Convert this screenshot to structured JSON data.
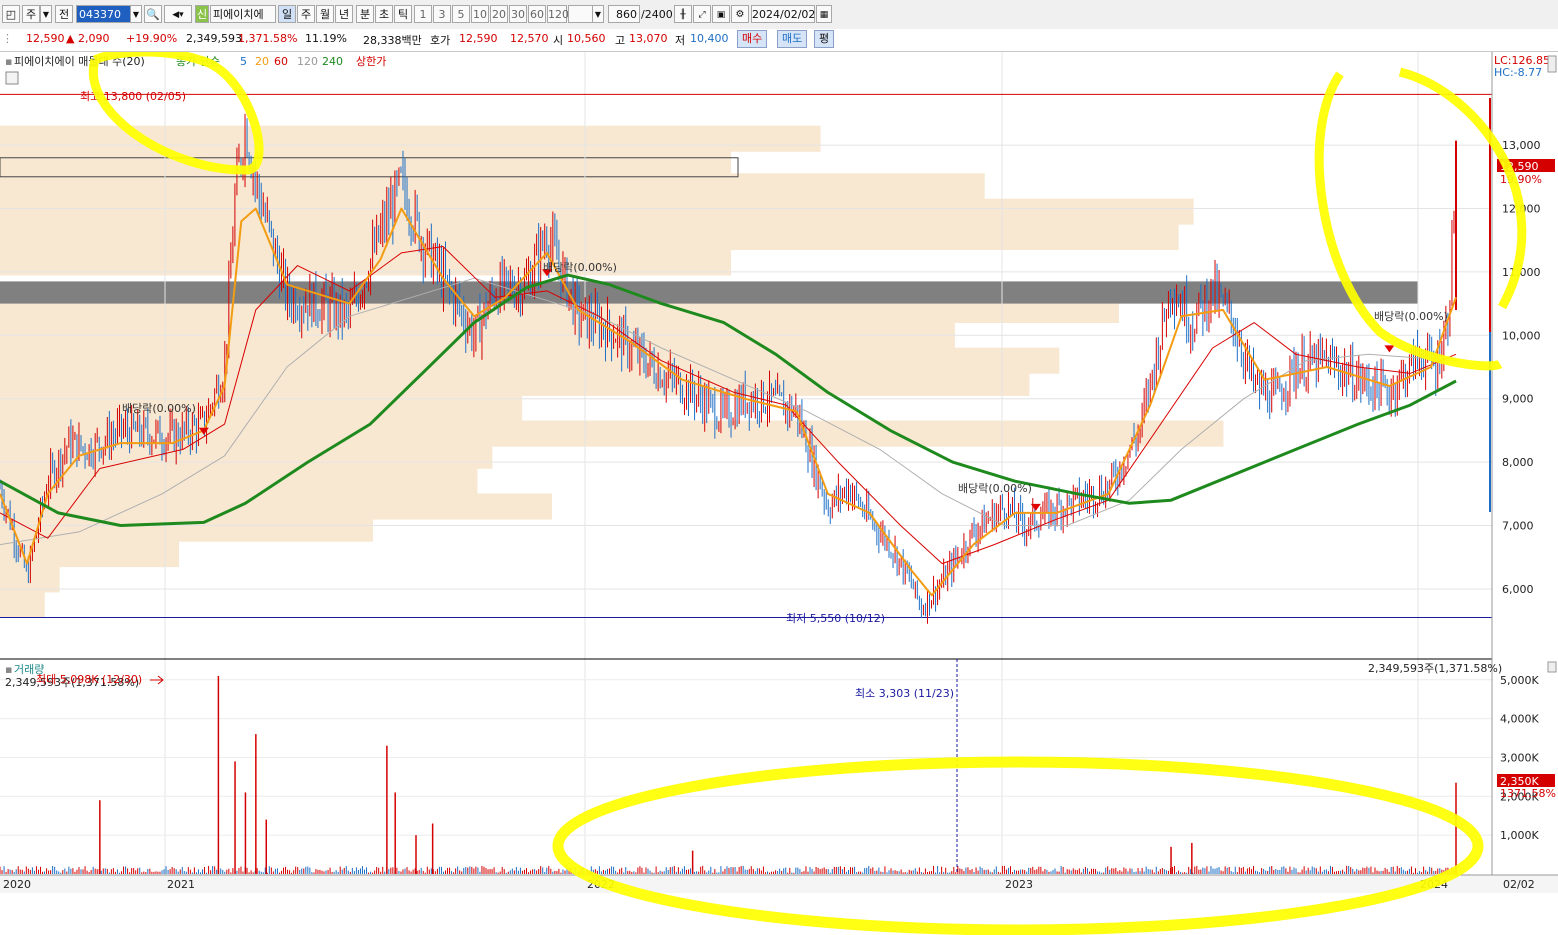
{
  "toolbar": {
    "period_main": "주",
    "prev": "전",
    "code": "043370",
    "stock_badge": "신",
    "stock_name": "피에이치에",
    "periods": [
      "일",
      "주",
      "월",
      "년",
      "분",
      "초",
      "틱"
    ],
    "active_period": "일",
    "intervals": [
      "1",
      "3",
      "5",
      "10",
      "20",
      "30",
      "60",
      "120"
    ],
    "count": "860",
    "count_total": "/2400",
    "date": "2024/02/02"
  },
  "quote": {
    "price": "12,590",
    "change": "▲ 2,090",
    "change_pct": "+19.90%",
    "volume": "2,349,593",
    "volume_pct": "1,371.58%",
    "turnover": "11.19%",
    "amount": "28,338백만",
    "ask_label": "호가",
    "ask": "12,590",
    "bid": "12,570",
    "open_label": "시",
    "open": "10,560",
    "high_label": "고",
    "high": "13,070",
    "low_label": "저",
    "low": "10,400",
    "buy": "매수",
    "sell": "매도",
    "avg": "평"
  },
  "colors": {
    "up": "#d40000",
    "down": "#1d6fc6",
    "ma5": "#f39c12",
    "ma20": "#d80000",
    "ma60": "#b0b0b0",
    "ma240": "#1e8a1e",
    "highlight": "#ffff00",
    "volume_profile": "#f8e8d2"
  },
  "chart_data": {
    "type": "line",
    "title": "피에이치에이 매물대 수(20)",
    "legend": [
      "종가 단순",
      "5",
      "20",
      "60",
      "120",
      "240",
      "상한가"
    ],
    "x_ticks": [
      "2020",
      "2021",
      "2022",
      "2023",
      "2024",
      "02/02"
    ],
    "ylim": [
      5400,
      13900
    ],
    "y_ticks": [
      "13,000",
      "12,000",
      "11,000",
      "10,000",
      "9,000",
      "8,000",
      "7,000",
      "6,000"
    ],
    "right_labels": {
      "lc": "LC:126.85",
      "hc": "HC:-8.77",
      "price": "12,590",
      "pct": "19.90%"
    },
    "max_label": "최고 13,800 (02/05)",
    "max_value": 13800,
    "min_label": "최저 5,550 (10/12)",
    "min_value": 5550,
    "dividend_labels": [
      "배당락(0.00%)",
      "배당락(0.00%)",
      "배당락(0.00%)",
      "배당락(0.00%)"
    ],
    "close_series": [
      {
        "x": 2019.92,
        "y": 7600
      },
      {
        "x": 2020.05,
        "y": 6200
      },
      {
        "x": 2020.15,
        "y": 7700
      },
      {
        "x": 2020.25,
        "y": 8300
      },
      {
        "x": 2020.35,
        "y": 8200
      },
      {
        "x": 2020.5,
        "y": 8500
      },
      {
        "x": 2020.75,
        "y": 8400
      },
      {
        "x": 2020.9,
        "y": 8600
      },
      {
        "x": 2021.0,
        "y": 9500
      },
      {
        "x": 2021.05,
        "y": 12200
      },
      {
        "x": 2021.1,
        "y": 13300
      },
      {
        "x": 2021.15,
        "y": 12400
      },
      {
        "x": 2021.2,
        "y": 11800
      },
      {
        "x": 2021.3,
        "y": 10600
      },
      {
        "x": 2021.45,
        "y": 10500
      },
      {
        "x": 2021.6,
        "y": 10300
      },
      {
        "x": 2021.75,
        "y": 11600
      },
      {
        "x": 2021.85,
        "y": 12400
      },
      {
        "x": 2021.95,
        "y": 11500
      },
      {
        "x": 2022.1,
        "y": 10600
      },
      {
        "x": 2022.2,
        "y": 10000
      },
      {
        "x": 2022.3,
        "y": 10700
      },
      {
        "x": 2022.45,
        "y": 10800
      },
      {
        "x": 2022.55,
        "y": 11600
      },
      {
        "x": 2022.7,
        "y": 10300
      },
      {
        "x": 2022.85,
        "y": 10100
      },
      {
        "x": 2022.95,
        "y": 9800
      },
      {
        "x": 2023.1,
        "y": 9400
      },
      {
        "x": 2023.25,
        "y": 9100
      },
      {
        "x": 2023.4,
        "y": 8700
      },
      {
        "x": 2023.5,
        "y": 9000
      },
      {
        "x": 2023.6,
        "y": 9000
      },
      {
        "x": 2023.75,
        "y": 8800
      },
      {
        "x": 2023.9,
        "y": 7300
      },
      {
        "x": 2024.0,
        "y": 7600
      },
      {
        "x": 2024.1,
        "y": 7100
      },
      {
        "x": 2024.2,
        "y": 6700
      },
      {
        "x": 2024.3,
        "y": 6100
      },
      {
        "x": 2024.35,
        "y": 5700
      },
      {
        "x": 2024.45,
        "y": 6100
      },
      {
        "x": 2024.6,
        "y": 6900
      },
      {
        "x": 2024.75,
        "y": 7300
      },
      {
        "x": 2024.85,
        "y": 7000
      },
      {
        "x": 2024.95,
        "y": 7200
      },
      {
        "x": 2025.1,
        "y": 7400
      },
      {
        "x": 2025.25,
        "y": 7600
      },
      {
        "x": 2025.4,
        "y": 8500
      },
      {
        "x": 2025.5,
        "y": 10000
      },
      {
        "x": 2025.55,
        "y": 10800
      },
      {
        "x": 2025.65,
        "y": 10200
      },
      {
        "x": 2025.75,
        "y": 10700
      },
      {
        "x": 2025.85,
        "y": 10200
      },
      {
        "x": 2025.95,
        "y": 9200
      },
      {
        "x": 2026.05,
        "y": 9000
      },
      {
        "x": 2026.15,
        "y": 9500
      },
      {
        "x": 2026.3,
        "y": 9600
      },
      {
        "x": 2026.45,
        "y": 9300
      },
      {
        "x": 2026.6,
        "y": 9100
      },
      {
        "x": 2026.75,
        "y": 9700
      },
      {
        "x": 2026.82,
        "y": 9500
      },
      {
        "x": 2026.88,
        "y": 10200
      },
      {
        "x": 2026.92,
        "y": 12590
      }
    ],
    "ma5": [
      {
        "x": 2019.92,
        "y": 7500
      },
      {
        "x": 2020.05,
        "y": 6400
      },
      {
        "x": 2020.15,
        "y": 7500
      },
      {
        "x": 2020.3,
        "y": 8100
      },
      {
        "x": 2020.5,
        "y": 8300
      },
      {
        "x": 2020.75,
        "y": 8300
      },
      {
        "x": 2020.9,
        "y": 8500
      },
      {
        "x": 2021.0,
        "y": 9200
      },
      {
        "x": 2021.08,
        "y": 11800
      },
      {
        "x": 2021.15,
        "y": 12000
      },
      {
        "x": 2021.3,
        "y": 10800
      },
      {
        "x": 2021.6,
        "y": 10500
      },
      {
        "x": 2021.75,
        "y": 11200
      },
      {
        "x": 2021.85,
        "y": 12000
      },
      {
        "x": 2022.05,
        "y": 10900
      },
      {
        "x": 2022.2,
        "y": 10300
      },
      {
        "x": 2022.35,
        "y": 10600
      },
      {
        "x": 2022.55,
        "y": 11300
      },
      {
        "x": 2022.7,
        "y": 10400
      },
      {
        "x": 2022.95,
        "y": 9900
      },
      {
        "x": 2023.2,
        "y": 9300
      },
      {
        "x": 2023.5,
        "y": 9000
      },
      {
        "x": 2023.75,
        "y": 8800
      },
      {
        "x": 2023.9,
        "y": 7500
      },
      {
        "x": 2024.1,
        "y": 7200
      },
      {
        "x": 2024.3,
        "y": 6300
      },
      {
        "x": 2024.4,
        "y": 5900
      },
      {
        "x": 2024.6,
        "y": 6700
      },
      {
        "x": 2024.8,
        "y": 7200
      },
      {
        "x": 2025.0,
        "y": 7200
      },
      {
        "x": 2025.25,
        "y": 7500
      },
      {
        "x": 2025.45,
        "y": 8900
      },
      {
        "x": 2025.6,
        "y": 10300
      },
      {
        "x": 2025.8,
        "y": 10400
      },
      {
        "x": 2026.0,
        "y": 9300
      },
      {
        "x": 2026.3,
        "y": 9500
      },
      {
        "x": 2026.6,
        "y": 9200
      },
      {
        "x": 2026.8,
        "y": 9500
      },
      {
        "x": 2026.92,
        "y": 10600
      }
    ],
    "ma20": [
      {
        "x": 2019.92,
        "y": 7200
      },
      {
        "x": 2020.15,
        "y": 6800
      },
      {
        "x": 2020.4,
        "y": 7900
      },
      {
        "x": 2020.8,
        "y": 8200
      },
      {
        "x": 2021.0,
        "y": 8600
      },
      {
        "x": 2021.15,
        "y": 10400
      },
      {
        "x": 2021.35,
        "y": 11100
      },
      {
        "x": 2021.6,
        "y": 10700
      },
      {
        "x": 2021.85,
        "y": 11300
      },
      {
        "x": 2022.05,
        "y": 11400
      },
      {
        "x": 2022.3,
        "y": 10600
      },
      {
        "x": 2022.55,
        "y": 10700
      },
      {
        "x": 2022.8,
        "y": 10300
      },
      {
        "x": 2023.1,
        "y": 9600
      },
      {
        "x": 2023.45,
        "y": 9100
      },
      {
        "x": 2023.7,
        "y": 8900
      },
      {
        "x": 2023.95,
        "y": 8000
      },
      {
        "x": 2024.25,
        "y": 7000
      },
      {
        "x": 2024.45,
        "y": 6400
      },
      {
        "x": 2024.7,
        "y": 6700
      },
      {
        "x": 2025.0,
        "y": 7100
      },
      {
        "x": 2025.25,
        "y": 7400
      },
      {
        "x": 2025.5,
        "y": 8600
      },
      {
        "x": 2025.75,
        "y": 9800
      },
      {
        "x": 2025.95,
        "y": 10200
      },
      {
        "x": 2026.15,
        "y": 9700
      },
      {
        "x": 2026.45,
        "y": 9500
      },
      {
        "x": 2026.7,
        "y": 9400
      },
      {
        "x": 2026.92,
        "y": 9700
      }
    ],
    "ma60": [
      {
        "x": 2019.92,
        "y": 6700
      },
      {
        "x": 2020.3,
        "y": 6900
      },
      {
        "x": 2020.7,
        "y": 7500
      },
      {
        "x": 2021.0,
        "y": 8100
      },
      {
        "x": 2021.3,
        "y": 9500
      },
      {
        "x": 2021.6,
        "y": 10300
      },
      {
        "x": 2021.9,
        "y": 10600
      },
      {
        "x": 2022.2,
        "y": 10900
      },
      {
        "x": 2022.5,
        "y": 10600
      },
      {
        "x": 2022.8,
        "y": 10300
      },
      {
        "x": 2023.1,
        "y": 9800
      },
      {
        "x": 2023.45,
        "y": 9300
      },
      {
        "x": 2023.8,
        "y": 8800
      },
      {
        "x": 2024.15,
        "y": 8200
      },
      {
        "x": 2024.45,
        "y": 7500
      },
      {
        "x": 2024.75,
        "y": 7000
      },
      {
        "x": 2025.05,
        "y": 7000
      },
      {
        "x": 2025.35,
        "y": 7400
      },
      {
        "x": 2025.6,
        "y": 8200
      },
      {
        "x": 2025.9,
        "y": 9000
      },
      {
        "x": 2026.2,
        "y": 9600
      },
      {
        "x": 2026.5,
        "y": 9700
      },
      {
        "x": 2026.92,
        "y": 9600
      }
    ],
    "ma240": [
      {
        "x": 2019.92,
        "y": 7700
      },
      {
        "x": 2020.2,
        "y": 7200
      },
      {
        "x": 2020.5,
        "y": 7000
      },
      {
        "x": 2020.9,
        "y": 7050
      },
      {
        "x": 2021.1,
        "y": 7350
      },
      {
        "x": 2021.4,
        "y": 8000
      },
      {
        "x": 2021.7,
        "y": 8600
      },
      {
        "x": 2021.95,
        "y": 9400
      },
      {
        "x": 2022.2,
        "y": 10200
      },
      {
        "x": 2022.45,
        "y": 10750
      },
      {
        "x": 2022.65,
        "y": 10950
      },
      {
        "x": 2022.85,
        "y": 10800
      },
      {
        "x": 2023.1,
        "y": 10500
      },
      {
        "x": 2023.4,
        "y": 10200
      },
      {
        "x": 2023.65,
        "y": 9700
      },
      {
        "x": 2023.9,
        "y": 9100
      },
      {
        "x": 2024.2,
        "y": 8500
      },
      {
        "x": 2024.5,
        "y": 8000
      },
      {
        "x": 2024.8,
        "y": 7700
      },
      {
        "x": 2025.1,
        "y": 7500
      },
      {
        "x": 2025.35,
        "y": 7350
      },
      {
        "x": 2025.55,
        "y": 7400
      },
      {
        "x": 2025.85,
        "y": 7800
      },
      {
        "x": 2026.15,
        "y": 8200
      },
      {
        "x": 2026.45,
        "y": 8600
      },
      {
        "x": 2026.7,
        "y": 8900
      },
      {
        "x": 2026.92,
        "y": 9280
      }
    ],
    "volume_profile": [
      {
        "price": 13100,
        "extent": 0.55
      },
      {
        "price": 12750,
        "extent": 0.49
      },
      {
        "price": 12350,
        "extent": 0.66
      },
      {
        "price": 11950,
        "extent": 0.8
      },
      {
        "price": 11550,
        "extent": 0.79
      },
      {
        "price": 11150,
        "extent": 0.49
      },
      {
        "price": 10400,
        "extent": 0.75
      },
      {
        "price": 10000,
        "extent": 0.64
      },
      {
        "price": 9600,
        "extent": 0.71
      },
      {
        "price": 9250,
        "extent": 0.69
      },
      {
        "price": 8850,
        "extent": 0.35
      },
      {
        "price": 8450,
        "extent": 0.82
      },
      {
        "price": 8100,
        "extent": 0.33
      },
      {
        "price": 7700,
        "extent": 0.32
      },
      {
        "price": 7300,
        "extent": 0.37
      },
      {
        "price": 6950,
        "extent": 0.25
      },
      {
        "price": 6550,
        "extent": 0.12
      },
      {
        "price": 6150,
        "extent": 0.04
      },
      {
        "price": 5750,
        "extent": 0.03
      }
    ],
    "volume_panel": {
      "title": "거래량",
      "left_label": "2,349,593주(1,371.58%)",
      "right_label": "2,349,593주(1,371.58%)",
      "max_label": "최대 5,098K (12/30)",
      "min_label": "최소 3,303 (11/23)",
      "y_ticks": [
        "5,000K",
        "4,000K",
        "3,000K",
        "2,000K",
        "1,000K"
      ],
      "ylim": [
        0,
        5200
      ],
      "last_label": "2,350K",
      "last_pct": "1371.58%",
      "spikes": [
        {
          "x": 2020.4,
          "v": 1900
        },
        {
          "x": 2020.97,
          "v": 5098
        },
        {
          "x": 2021.05,
          "v": 2900
        },
        {
          "x": 2021.1,
          "v": 2100
        },
        {
          "x": 2021.15,
          "v": 3600
        },
        {
          "x": 2021.2,
          "v": 1400
        },
        {
          "x": 2021.78,
          "v": 3300
        },
        {
          "x": 2021.82,
          "v": 2100
        },
        {
          "x": 2021.92,
          "v": 1000
        },
        {
          "x": 2022.0,
          "v": 1300
        },
        {
          "x": 2023.25,
          "v": 600
        },
        {
          "x": 2025.55,
          "v": 700
        },
        {
          "x": 2025.65,
          "v": 800
        },
        {
          "x": 2026.92,
          "v": 2350
        }
      ]
    }
  }
}
